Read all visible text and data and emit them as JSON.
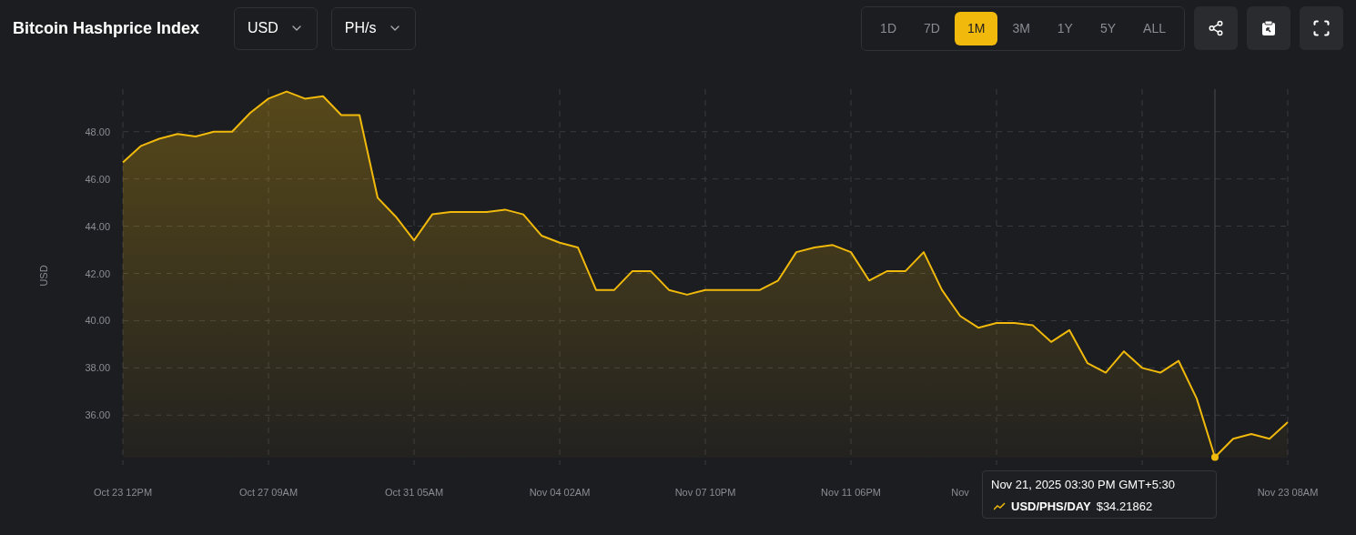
{
  "title": "Bitcoin Hashprice Index",
  "dropdowns": [
    {
      "label": "USD"
    },
    {
      "label": "PH/s"
    }
  ],
  "ranges": [
    {
      "label": "1D",
      "selected": false
    },
    {
      "label": "7D",
      "selected": false
    },
    {
      "label": "1M",
      "selected": true
    },
    {
      "label": "3M",
      "selected": false
    },
    {
      "label": "1Y",
      "selected": false
    },
    {
      "label": "5Y",
      "selected": false
    },
    {
      "label": "ALL",
      "selected": false
    }
  ],
  "chart": {
    "chart_data": {
      "type": "area",
      "ylabel": "USD",
      "categories": [
        "Oct 23 12PM",
        null,
        null,
        null,
        null,
        null,
        null,
        null,
        "Oct 27 09AM",
        null,
        null,
        null,
        null,
        null,
        null,
        null,
        "Oct 31 05AM",
        null,
        null,
        null,
        null,
        null,
        null,
        null,
        "Nov 04 02AM",
        null,
        null,
        null,
        null,
        null,
        null,
        null,
        "Nov 07 10PM",
        null,
        null,
        null,
        null,
        null,
        null,
        null,
        "Nov 11 06PM",
        null,
        null,
        null,
        null,
        null,
        "Nov",
        null,
        null,
        null,
        null,
        null,
        null,
        null,
        null,
        null,
        null,
        null,
        null,
        null,
        null,
        null,
        null,
        null,
        "Nov 23 08AM"
      ],
      "series": [
        {
          "name": "USD/PHS/DAY",
          "color": "#f0b90b",
          "values": [
            46.7,
            47.4,
            47.7,
            47.9,
            47.8,
            48.0,
            48.0,
            48.8,
            49.4,
            49.7,
            49.4,
            49.5,
            48.7,
            48.7,
            45.2,
            44.4,
            43.4,
            44.5,
            44.6,
            44.6,
            44.6,
            44.7,
            44.5,
            43.6,
            43.3,
            43.1,
            41.3,
            41.3,
            42.1,
            42.1,
            41.3,
            41.1,
            41.3,
            41.3,
            41.3,
            41.3,
            41.7,
            42.9,
            43.1,
            43.2,
            42.9,
            41.7,
            42.1,
            42.1,
            42.9,
            41.3,
            40.2,
            39.7,
            39.9,
            39.9,
            39.8,
            39.1,
            39.6,
            38.2,
            37.8,
            38.7,
            38.0,
            37.8,
            38.3,
            36.7,
            34.22,
            35.0,
            35.2,
            35.0,
            35.7
          ]
        }
      ],
      "ylim": [
        34.2,
        49.8
      ],
      "yticks": [
        {
          "value": 36,
          "label": "36.00"
        },
        {
          "value": 38,
          "label": "38.00"
        },
        {
          "value": 40,
          "label": "40.00"
        },
        {
          "value": 42,
          "label": "42.00"
        },
        {
          "value": 44,
          "label": "44.00"
        },
        {
          "value": 46,
          "label": "46.00"
        },
        {
          "value": 48,
          "label": "48.00"
        }
      ],
      "grid": true
    }
  },
  "tooltip": {
    "time": "Nov 21, 2025 03:30 PM GMT+5:30",
    "value": "$34.21862"
  }
}
